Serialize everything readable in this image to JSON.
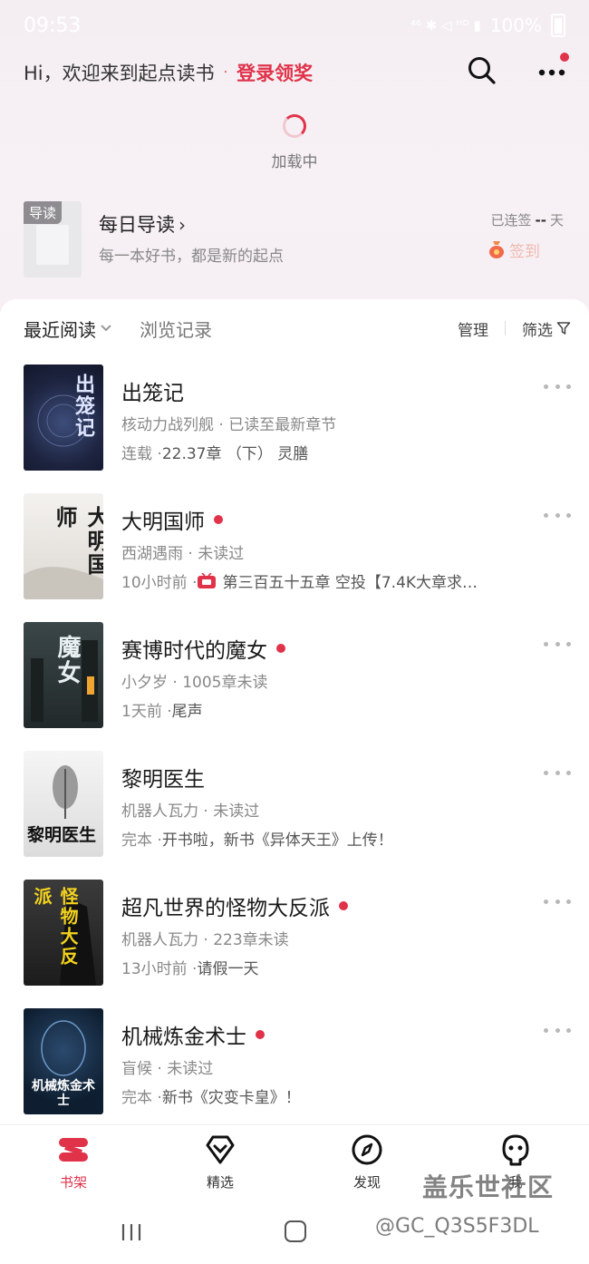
{
  "status_bar": {
    "time": "09:53",
    "indicators": "⁴⁶ ✱ ◁ ᴴᴰ ▮",
    "battery": "100%"
  },
  "header": {
    "greeting": "Hi，欢迎来到起点读书",
    "separator": "·",
    "login_label": "登录领奖"
  },
  "loading_text": "加载中",
  "daily_guide": {
    "tag": "导读",
    "title": "每日导读",
    "subtitle": "每一本好书，都是新的起点",
    "streak_prefix": "已连签",
    "streak_value": "--",
    "streak_suffix": "天",
    "checkin_label": "签到"
  },
  "shelf_tabs": {
    "recent": "最近阅读",
    "history": "浏览记录",
    "manage": "管理",
    "filter": "筛选"
  },
  "books": [
    {
      "title": "出笼记",
      "cover_text": "出笼记",
      "unread": false,
      "line1": "核动力战列舰 · 已读至最新章节",
      "line2_prefix": "连载 · ",
      "line2_update": "22.37章 （下） 灵膳",
      "tv": false,
      "cover_bg": "#1d2440"
    },
    {
      "title": "大明国师",
      "cover_text": "大明国师",
      "unread": true,
      "line1": "西湖遇雨 · 未读过",
      "line2_prefix": "10小时前 · ",
      "line2_update": "第三百五十五章 空投【7.4K大章求…",
      "tv": true,
      "cover_bg": "#e9e6e3"
    },
    {
      "title": "赛博时代的魔女",
      "cover_text": "魔女",
      "unread": true,
      "line1": "小夕岁 · 1005章未读",
      "line2_prefix": "1天前 · ",
      "line2_update": "尾声",
      "tv": false,
      "cover_bg": "#2d3434"
    },
    {
      "title": "黎明医生",
      "cover_text": "黎明医生",
      "unread": false,
      "line1": "机器人瓦力 · 未读过",
      "line2_prefix": "完本 · ",
      "line2_update": "开书啦，新书《异体天王》上传！",
      "tv": false,
      "cover_bg": "#eeeeee"
    },
    {
      "title": "超凡世界的怪物大反派",
      "cover_text": "怪物大反派",
      "unread": true,
      "line1": "机器人瓦力 · 223章未读",
      "line2_prefix": "13小时前 · ",
      "line2_update": "请假一天",
      "tv": false,
      "cover_bg": "#2a2a2a"
    },
    {
      "title": "机械炼金术士",
      "cover_text": "机械炼金术士",
      "unread": true,
      "line1": "盲候 · 未读过",
      "line2_prefix": "完本 · ",
      "line2_update": "新书《灾变卡皇》！",
      "tv": false,
      "cover_bg": "#0e1e30"
    }
  ],
  "bottom_nav": [
    {
      "label": "书架",
      "icon": "bookshelf-icon",
      "active": true
    },
    {
      "label": "精选",
      "icon": "diamond-icon",
      "active": false
    },
    {
      "label": "发现",
      "icon": "compass-icon",
      "active": false
    },
    {
      "label": "我",
      "icon": "profile-icon",
      "active": false
    }
  ],
  "watermark": {
    "line1": "盖乐世社区",
    "line2": "@GC_Q3S5F3DL"
  },
  "colors": {
    "accent": "#e0334a",
    "muted": "#888888"
  }
}
